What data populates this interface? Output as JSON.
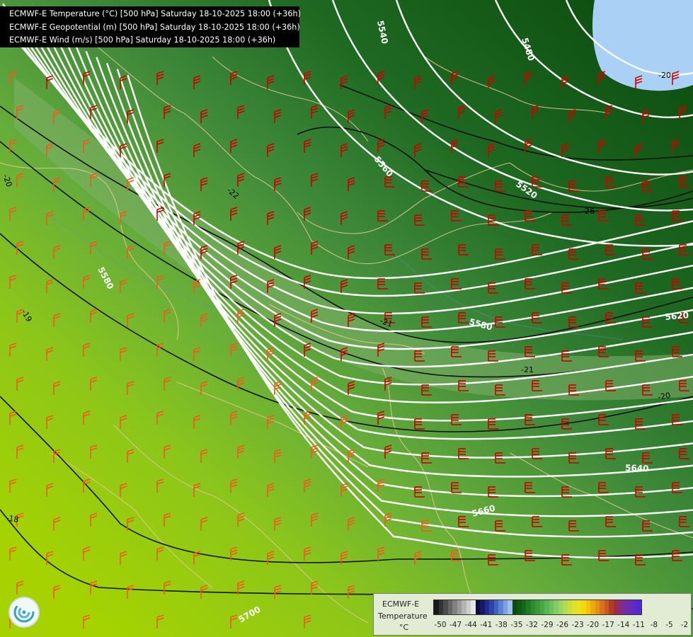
{
  "titles": [
    "ECMWF-E Temperature (°C) [500 hPa] Saturday 18-10-2025 18:00 (+36h)",
    "ECMWF-E Geopotential (m) [500 hPa] Saturday 18-10-2025 18:00 (+36h)",
    "ECMWF-E Wind (m/s) [500 hPa] Saturday 18-10-2025 18:00 (+36h)"
  ],
  "legend": {
    "model": "ECMWF-E",
    "field": "Temperature",
    "unit": "°C",
    "ticks": [
      "-50",
      "-47",
      "-44",
      "-41",
      "-38",
      "-35",
      "-32",
      "-29",
      "-26",
      "-23",
      "-20",
      "-17",
      "-14",
      "-11",
      "-8",
      "-5",
      "-2"
    ],
    "colors": [
      "#1a1a1a",
      "#333333",
      "#4d4d4d",
      "#666666",
      "#808080",
      "#9a9a9a",
      "#b4b4b4",
      "#cdcdcd",
      "#e6e6e6",
      "#0b0b40",
      "#141a66",
      "#1f2c8a",
      "#2e44a8",
      "#4461c1",
      "#5e80d4",
      "#7ca0e0",
      "#9dbfea",
      "#0a4a0a",
      "#0f5a12",
      "#17691a",
      "#217a23",
      "#2d8a2e",
      "#3a993a",
      "#48a846",
      "#58b552",
      "#6bc25e",
      "#80cc66",
      "#9ad35f",
      "#b3d94f",
      "#cadf3e",
      "#dde22c",
      "#ece21a",
      "#f4d80f",
      "#f2c20e",
      "#eea911",
      "#e58f16",
      "#d9741b",
      "#c85a1f",
      "#b23e21",
      "#9c2b45",
      "#8a2a7a",
      "#7a2aa0",
      "#6c2ab8",
      "#5e2ac8",
      "#4e2ad0"
    ]
  },
  "contours": {
    "geopotential_labels": [
      "5540",
      "5480",
      "5560",
      "5520",
      "5580",
      "5580",
      "5620",
      "5640",
      "5660",
      "5700"
    ],
    "temperature_labels": [
      "-20",
      "-26",
      "-22",
      "-19",
      "-20",
      "-21",
      "-20",
      "-18",
      "-21"
    ]
  }
}
